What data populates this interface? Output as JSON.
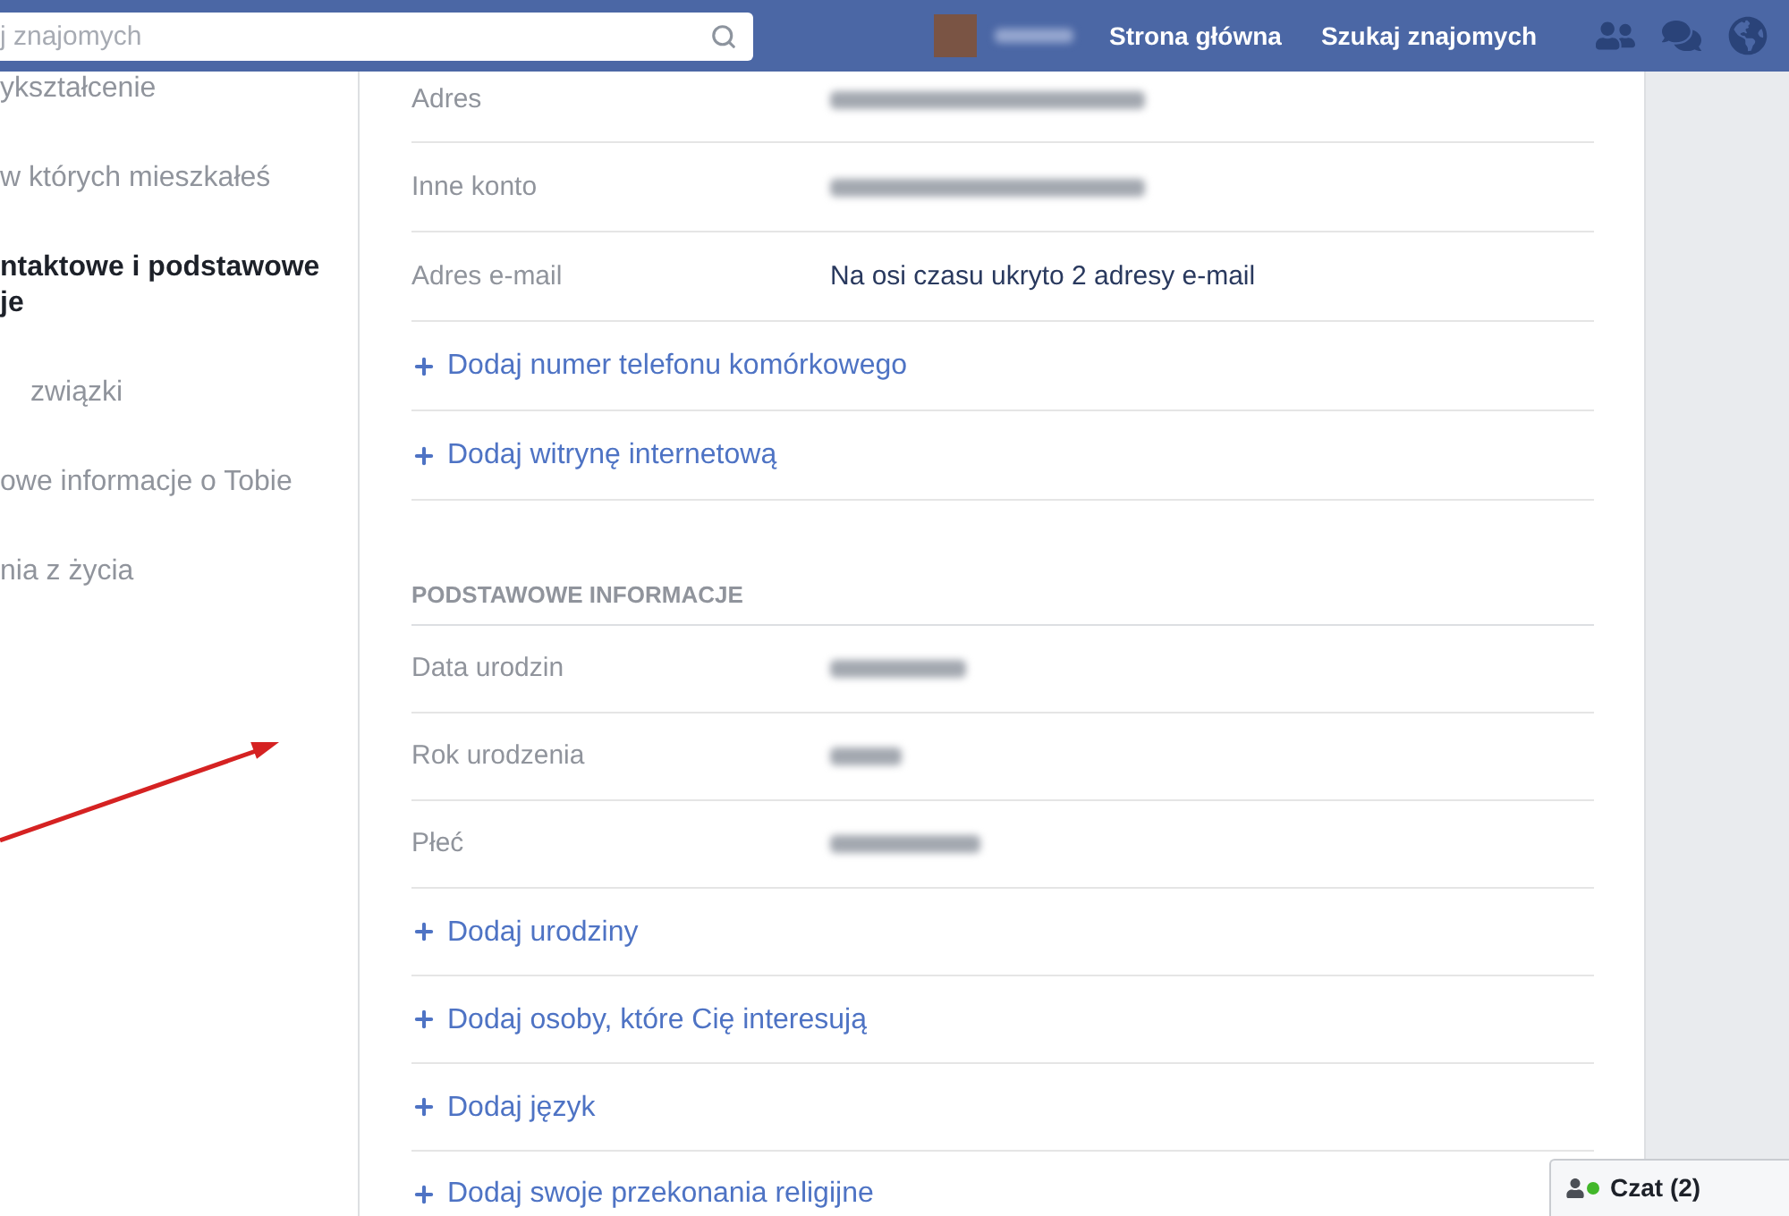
{
  "header": {
    "search": {
      "placeholder": "j znajomych"
    },
    "nav": [
      {
        "label": "Strona główna"
      },
      {
        "label": "Szukaj znajomych"
      }
    ]
  },
  "sidebar": {
    "items": [
      {
        "label": "ykształcenie",
        "selected": false
      },
      {
        "label": "w których mieszkałeś",
        "selected": false
      },
      {
        "label": "ntaktowe i podstawowe je",
        "selected": true
      },
      {
        "label": "związki",
        "selected": false
      },
      {
        "label": "owe informacje o Tobie",
        "selected": false
      },
      {
        "label": "nia z życia",
        "selected": false
      }
    ]
  },
  "contact": {
    "rows": [
      {
        "kind": "redacted",
        "label": "Adres"
      },
      {
        "kind": "redacted",
        "label": "Inne konto"
      },
      {
        "kind": "field",
        "label": "Adres e-mail",
        "value": "Na osi czasu ukryto 2 adresy e-mail"
      },
      {
        "kind": "add",
        "label": "Dodaj numer telefonu komórkowego"
      },
      {
        "kind": "add",
        "label": "Dodaj witrynę internetową"
      }
    ]
  },
  "basic": {
    "title": "PODSTAWOWE INFORMACJE",
    "rows": [
      {
        "kind": "redacted",
        "label": "Data urodzin"
      },
      {
        "kind": "redacted",
        "label": "Rok urodzenia"
      },
      {
        "kind": "redacted",
        "label": "Płeć"
      },
      {
        "kind": "add",
        "label": "Dodaj urodziny"
      },
      {
        "kind": "add",
        "label": "Dodaj osoby, które Cię interesują"
      },
      {
        "kind": "add",
        "label": "Dodaj język"
      },
      {
        "kind": "add",
        "label": "Dodaj swoje przekonania religijne"
      }
    ]
  },
  "chat": {
    "label": "Czat (2)",
    "online": true
  }
}
